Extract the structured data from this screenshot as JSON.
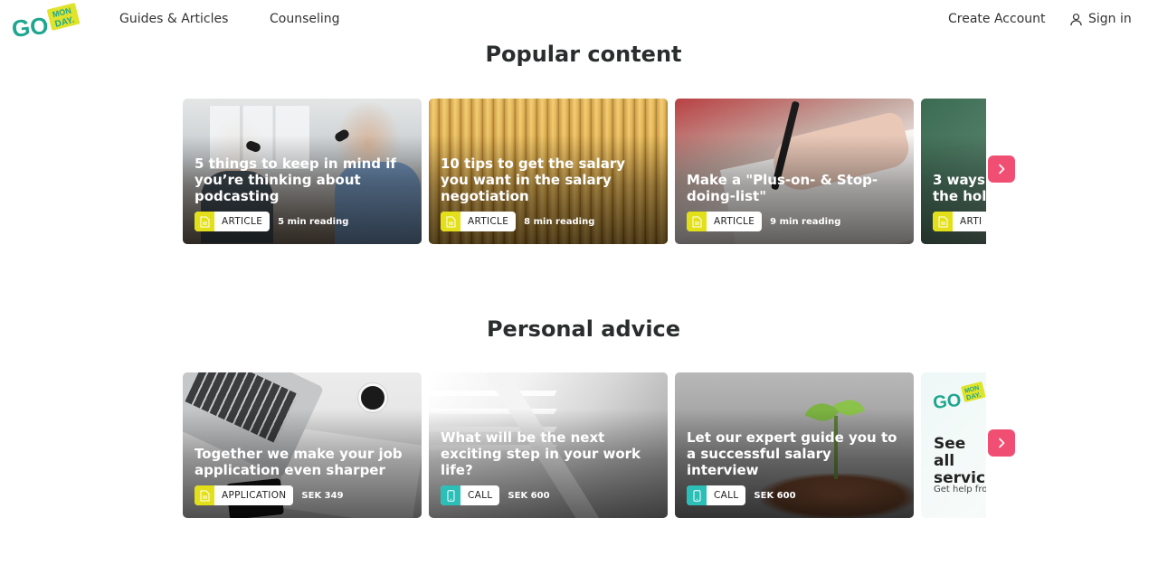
{
  "brand": {
    "logo_primary": "GO",
    "logo_secondary_line1": "MON",
    "logo_secondary_line2": "DAY.",
    "green": "#1fa68f",
    "yellow": "#dfe32a",
    "accent_pink": "#f04f73"
  },
  "header": {
    "nav": {
      "guides_label": "Guides & Articles",
      "counseling_label": "Counseling"
    },
    "account": {
      "create_label": "Create Account",
      "signin_label": "Sign in",
      "signin_icon": "user-icon"
    }
  },
  "popular": {
    "title": "Popular content",
    "next_icon": "chevron-right-icon",
    "cards": [
      {
        "title": "5 things to keep in mind if you’re thinking about podcasting",
        "tag": "ARTICLE",
        "tag_icon": "document-icon",
        "meta": "5 min reading"
      },
      {
        "title": "10 tips to get the salary you want in the salary negotiation",
        "tag": "ARTICLE",
        "tag_icon": "document-icon",
        "meta": "8 min reading"
      },
      {
        "title": "Make a \"Plus-on- & Stop-doing-list\"",
        "tag": "ARTICLE",
        "tag_icon": "document-icon",
        "meta": "9 min reading"
      },
      {
        "title": "3 ways the hol",
        "tag": "ARTI",
        "tag_icon": "document-icon",
        "meta": ""
      }
    ]
  },
  "advice": {
    "title": "Personal advice",
    "next_icon": "chevron-right-icon",
    "cards": [
      {
        "title": "Together we make your job application even sharper",
        "tag": "APPLICATION",
        "tag_icon": "document-icon",
        "tag_color": "#e3e01a",
        "meta": "SEK 349"
      },
      {
        "title": "What will be the next exciting step in your work life?",
        "tag": "CALL",
        "tag_icon": "phone-icon",
        "tag_color": "#2bbfb8",
        "meta": "SEK 600"
      },
      {
        "title": "Let our expert guide you to a successful salary interview",
        "tag": "CALL",
        "tag_icon": "phone-icon",
        "tag_color": "#2bbfb8",
        "meta": "SEK 600"
      }
    ],
    "promo": {
      "title": "See all servic",
      "subtitle": "Get help fro"
    }
  }
}
